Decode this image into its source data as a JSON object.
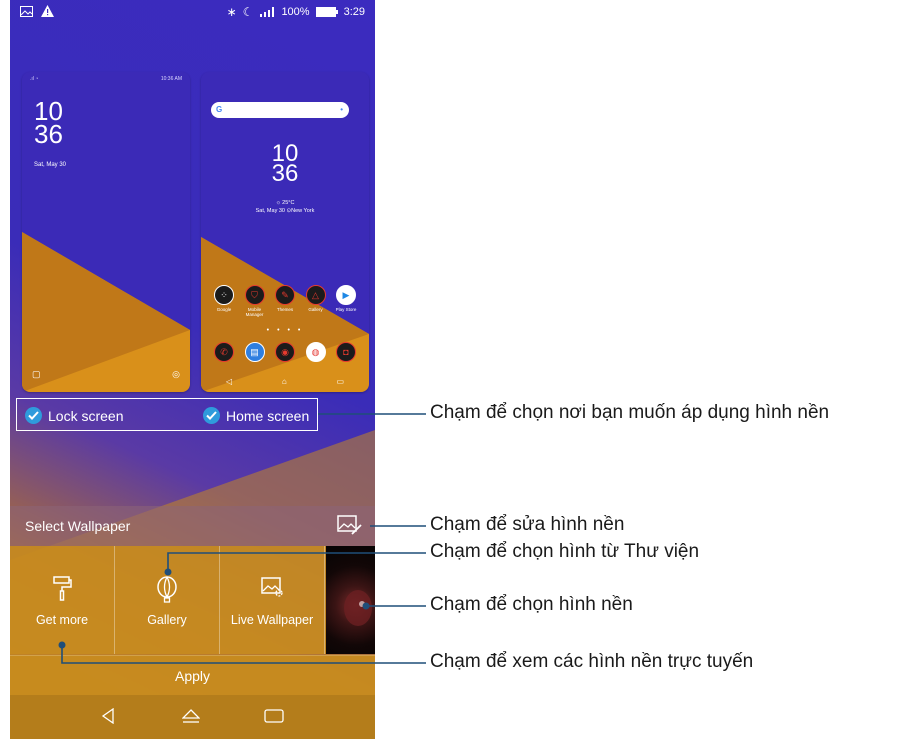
{
  "status_bar": {
    "battery": "100%",
    "time": "3:29"
  },
  "lock_preview": {
    "status_time": "10:36 AM",
    "clock_hour": "10",
    "clock_minute": "36",
    "date": "Sat, May 30"
  },
  "home_preview": {
    "clock_hour": "10",
    "clock_minute": "36",
    "temperature": "☼ 25°C",
    "date_location": "Sat, May 30  ⊙New York",
    "apps_row1": [
      "Google",
      "Mobile Manager",
      "Themes",
      "Gallery",
      "Play Store"
    ]
  },
  "targets": {
    "lock_label": "Lock screen",
    "home_label": "Home screen"
  },
  "select_wallpaper": {
    "title": "Select Wallpaper"
  },
  "options": {
    "get_more": "Get more",
    "gallery": "Gallery",
    "live_wallpaper": "Live Wallpaper"
  },
  "apply_label": "Apply",
  "annotations": {
    "apply_target": "Chạm để chọn nơi bạn muốn áp dụng hình nền",
    "edit": "Chạm để sửa hình nền",
    "gallery": "Chạm để chọn hình từ Thư viện",
    "choose": "Chạm để chọn hình nền",
    "online": "Chạm để xem các hình nền trực tuyến"
  },
  "colors": {
    "accent_check": "#2f9bdc",
    "wallpaper_blue": "#3b2bbf",
    "wallpaper_orange": "#c78a1e",
    "annotation_line": "#1f4e79"
  },
  "icons": [
    "gallery-status-icon",
    "warning-icon",
    "bluetooth-icon",
    "moon-icon",
    "signal-icon",
    "battery-icon",
    "check-icon",
    "edit-wallpaper-icon",
    "paint-roller-icon",
    "balloon-icon",
    "live-wallpaper-icon",
    "back-icon",
    "home-icon",
    "recents-icon"
  ]
}
